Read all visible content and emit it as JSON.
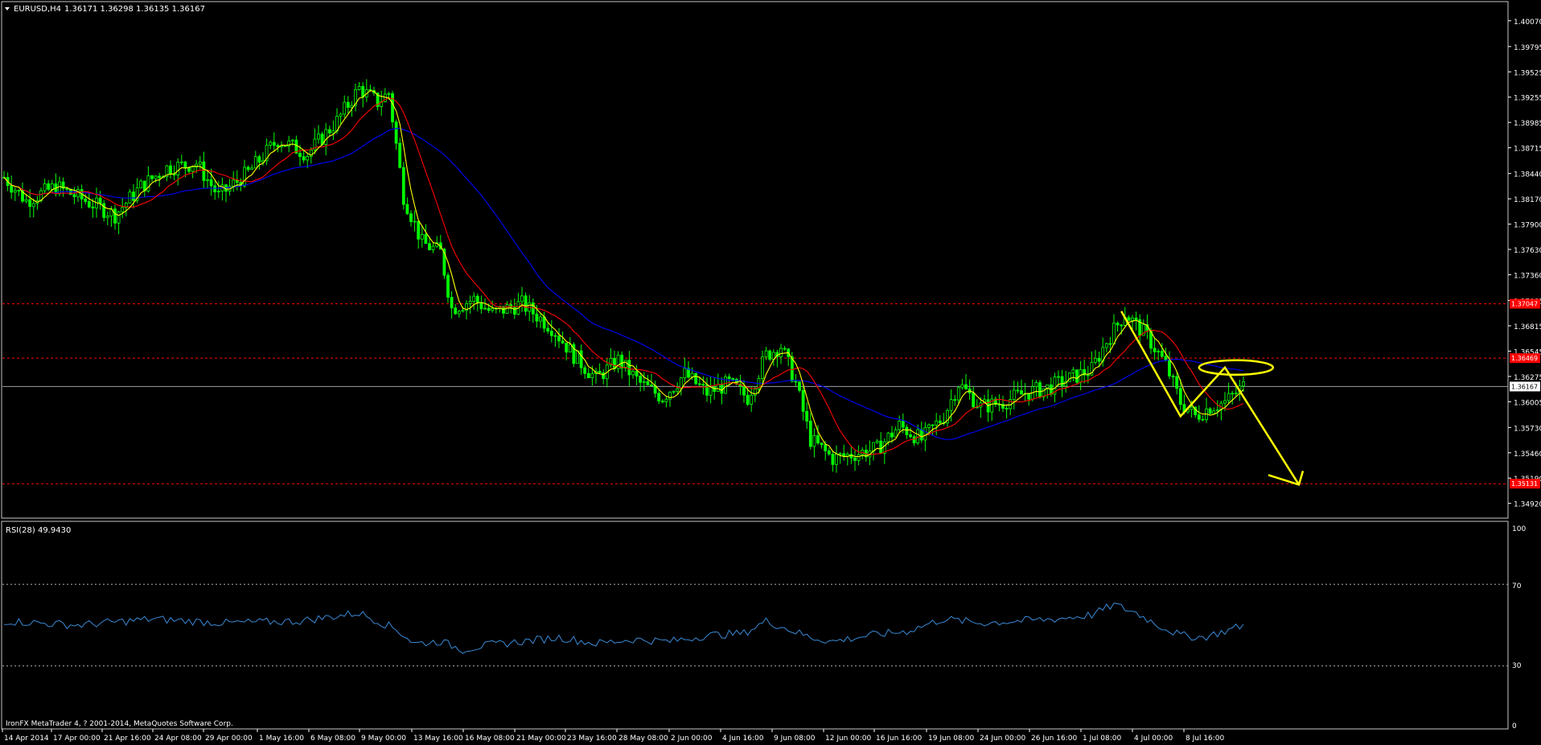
{
  "header": {
    "symbol": "EURUSD,H4",
    "ohlc": "1.36171 1.36298 1.36135 1.36167"
  },
  "indicator": {
    "label": "RSI(28) 49.9430",
    "axis": [
      "100",
      "70",
      "30",
      "0"
    ]
  },
  "copyright": "IronFX MetaTrader 4, ? 2001-2014, MetaQuotes Software Corp.",
  "colors": {
    "background": "#000000",
    "axis": "#ffffff",
    "candles": "#00ff00",
    "ma_fast": "#ffff00",
    "ma_mid": "#ff0000",
    "ma_slow": "#0000ff",
    "rsi": "#3a8ad6",
    "sr_line": "#ff0000",
    "annotation": "#ffff00"
  },
  "chart_data": [
    {
      "type": "candlestick",
      "title": "EURUSD,H4",
      "ylim": [
        1.3478,
        1.4024
      ],
      "yticks": [
        "1.40070",
        "1.39795",
        "1.39525",
        "1.39255",
        "1.38985",
        "1.38715",
        "1.38440",
        "1.38170",
        "1.37900",
        "1.37630",
        "1.37360",
        "1.37085",
        "1.36815",
        "1.36545",
        "1.36275",
        "1.36005",
        "1.35730",
        "1.35460",
        "1.35190",
        "1.34920"
      ],
      "xticks": [
        "14 Apr 2014",
        "17 Apr 00:00",
        "21 Apr 16:00",
        "24 Apr 08:00",
        "29 Apr 00:00",
        "1 May 16:00",
        "6 May 08:00",
        "9 May 00:00",
        "13 May 16:00",
        "16 May 08:00",
        "21 May 00:00",
        "23 May 16:00",
        "28 May 08:00",
        "2 Jun 00:00",
        "4 Jun 16:00",
        "9 Jun 08:00",
        "12 Jun 00:00",
        "16 Jun 16:00",
        "19 Jun 08:00",
        "24 Jun 00:00",
        "26 Jun 16:00",
        "1 Jul 08:00",
        "4 Jul 00:00",
        "8 Jul 16:00"
      ],
      "current_price": "1.36167",
      "levels": [
        {
          "value": 1.3705,
          "label": "1.37047"
        },
        {
          "value": 1.3647,
          "label": "1.36469"
        },
        {
          "value": 1.3513,
          "label": "1.35131"
        }
      ],
      "close_path": [
        [
          0,
          1.384
        ],
        [
          6,
          1.3815
        ],
        [
          14,
          1.383
        ],
        [
          22,
          1.3815
        ],
        [
          30,
          1.38
        ],
        [
          37,
          1.383
        ],
        [
          44,
          1.385
        ],
        [
          52,
          1.3855
        ],
        [
          58,
          1.382
        ],
        [
          66,
          1.3845
        ],
        [
          74,
          1.388
        ],
        [
          82,
          1.3865
        ],
        [
          90,
          1.39
        ],
        [
          96,
          1.3935
        ],
        [
          101,
          1.392
        ],
        [
          104,
          1.393
        ],
        [
          108,
          1.382
        ],
        [
          113,
          1.377
        ],
        [
          118,
          1.376
        ],
        [
          121,
          1.37
        ],
        [
          127,
          1.371
        ],
        [
          132,
          1.3695
        ],
        [
          140,
          1.3705
        ],
        [
          148,
          1.368
        ],
        [
          154,
          1.365
        ],
        [
          160,
          1.3625
        ],
        [
          166,
          1.3645
        ],
        [
          172,
          1.362
        ],
        [
          178,
          1.3605
        ],
        [
          184,
          1.363
        ],
        [
          190,
          1.361
        ],
        [
          196,
          1.362
        ],
        [
          201,
          1.3605
        ],
        [
          206,
          1.365
        ],
        [
          210,
          1.366
        ],
        [
          214,
          1.362
        ],
        [
          218,
          1.356
        ],
        [
          224,
          1.354
        ],
        [
          230,
          1.3545
        ],
        [
          236,
          1.355
        ],
        [
          242,
          1.3575
        ],
        [
          248,
          1.356
        ],
        [
          254,
          1.3585
        ],
        [
          258,
          1.362
        ],
        [
          264,
          1.3595
        ],
        [
          270,
          1.36
        ],
        [
          276,
          1.361
        ],
        [
          282,
          1.3615
        ],
        [
          288,
          1.3625
        ],
        [
          294,
          1.3635
        ],
        [
          298,
          1.3665
        ],
        [
          303,
          1.3695
        ],
        [
          309,
          1.367
        ],
        [
          314,
          1.364
        ],
        [
          318,
          1.36
        ],
        [
          322,
          1.3585
        ],
        [
          326,
          1.3595
        ],
        [
          330,
          1.36
        ],
        [
          335,
          1.3617
        ]
      ],
      "annotations": {
        "zigzag": [
          [
            1.3697
          ],
          [
            1.3585
          ],
          [
            1.3637
          ],
          [
            1.3512
          ]
        ],
        "ellipse_center_price": 1.3637
      }
    },
    {
      "type": "line",
      "title": "RSI(28) 49.9430",
      "ylim": [
        0,
        100
      ],
      "levels": [
        70,
        30
      ],
      "rsi_path": [
        [
          0,
          52
        ],
        [
          20,
          50
        ],
        [
          40,
          53
        ],
        [
          60,
          51
        ],
        [
          80,
          52
        ],
        [
          96,
          56
        ],
        [
          101,
          52
        ],
        [
          106,
          48
        ],
        [
          111,
          41
        ],
        [
          118,
          42
        ],
        [
          124,
          38
        ],
        [
          130,
          40
        ],
        [
          140,
          42
        ],
        [
          150,
          44
        ],
        [
          160,
          41
        ],
        [
          170,
          43
        ],
        [
          180,
          42
        ],
        [
          190,
          45
        ],
        [
          200,
          46
        ],
        [
          206,
          52
        ],
        [
          212,
          48
        ],
        [
          218,
          44
        ],
        [
          224,
          42
        ],
        [
          234,
          45
        ],
        [
          244,
          47
        ],
        [
          254,
          53
        ],
        [
          264,
          51
        ],
        [
          274,
          52
        ],
        [
          284,
          53
        ],
        [
          294,
          55
        ],
        [
          300,
          60
        ],
        [
          306,
          56
        ],
        [
          312,
          50
        ],
        [
          318,
          45
        ],
        [
          324,
          44
        ],
        [
          330,
          47
        ],
        [
          335,
          50
        ]
      ]
    }
  ]
}
